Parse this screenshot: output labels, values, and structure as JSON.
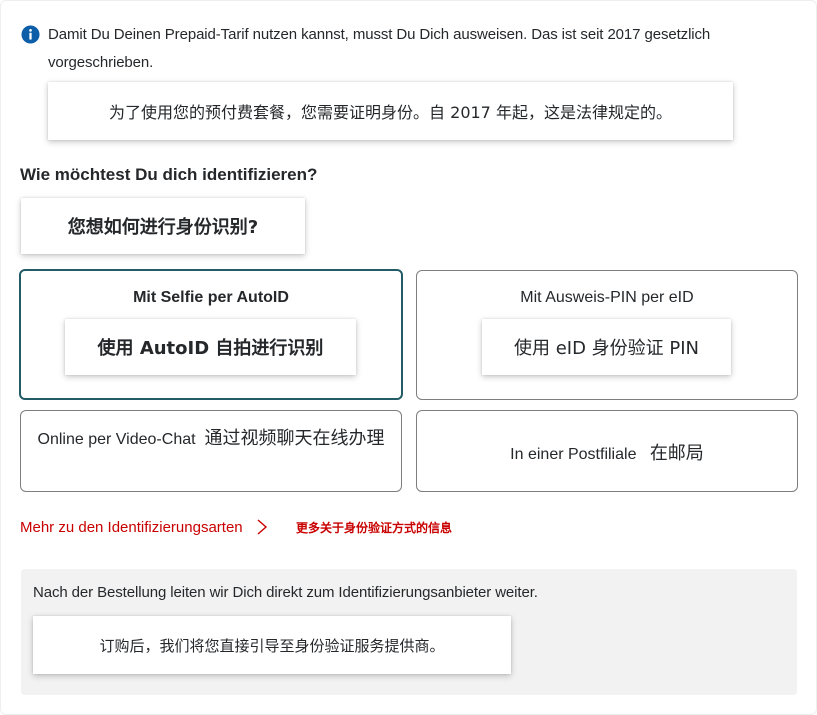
{
  "info": {
    "icon": "info-icon",
    "text": "Damit Du Deinen Prepaid-Tarif nutzen kannst, musst Du Dich ausweisen. Das ist seit 2017 gesetzlich vorgeschrieben.",
    "translation": "为了使用您的预付费套餐，您需要证明身份。自 2017 年起，这是法律规定的。"
  },
  "question": {
    "label": "Wie möchtest Du dich identifizieren?",
    "translation": "您想如何进行身份识别?"
  },
  "options": [
    {
      "label": "Mit Selfie per AutoID",
      "translation": "使用 AutoID 自拍进行识别",
      "selected": true
    },
    {
      "label": "Mit Ausweis-PIN per eID",
      "translation": "使用 eID 身份验证 PIN",
      "selected": false
    },
    {
      "label": "Online per Video-Chat",
      "translation": "通过视频聊天在线办理",
      "selected": false
    },
    {
      "label": "In einer Postfiliale",
      "translation": "在邮局",
      "selected": false
    }
  ],
  "more": {
    "label": "Mehr zu den Identifizierungsarten",
    "translation": "更多关于身份验证方式的信息"
  },
  "notice": {
    "text": "Nach der Bestellung leiten wir Dich direkt zum Identifizierungsanbieter weiter.",
    "translation": "订购后，我们将您直接引导至身份验证服务提供商。"
  },
  "colors": {
    "accent": "#235c66",
    "link": "#c90000",
    "info_icon": "#0d5ea8",
    "notice_bg": "#f2f2f2"
  }
}
